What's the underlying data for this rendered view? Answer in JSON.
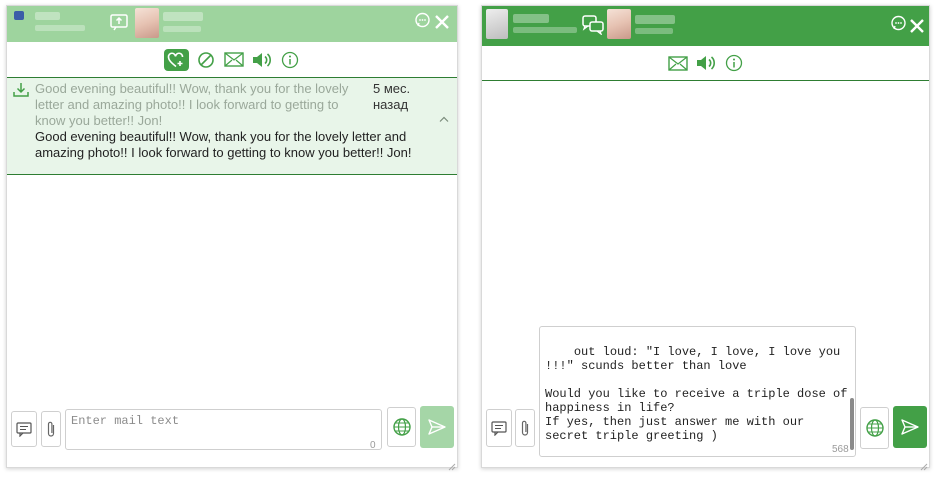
{
  "left_chat": {
    "message": {
      "preview": "Good evening beautiful!! Wow, thank you for the lovely letter and amazing photo!! I look forward to getting to know you better!! Jon!",
      "time": "5 мес. назад",
      "full": "Good evening beautiful!! Wow, thank you for the lovely letter and amazing photo!! I look forward to getting to know you better!! Jon!"
    },
    "composer": {
      "placeholder": "Enter mail text",
      "counter": "0"
    }
  },
  "right_chat": {
    "composer": {
      "text": "out loud: \"I love, I love, I love you !!!\" scunds better than love\n\nWould you like to receive a triple dose of happiness in life?\nIf yes, then just answer me with our secret triple greeting )\n\nKiss, kiss, kiss you",
      "counter": "568"
    }
  },
  "colors": {
    "header_light": "#9ed49e",
    "header_dark": "#43a047",
    "accent": "#43a047",
    "message_bg": "#e8f5e9",
    "send_disabled": "#a5d6a7"
  },
  "icons": [
    "upload-photo-icon",
    "chats-icon",
    "comment-icon",
    "close-icon",
    "heart-plus-icon",
    "block-icon",
    "mail-icon",
    "sound-icon",
    "info-icon",
    "download-icon",
    "chevron-up-icon",
    "message-templates-icon",
    "attachment-icon",
    "globe-icon",
    "send-icon",
    "resize-grip-icon"
  ]
}
